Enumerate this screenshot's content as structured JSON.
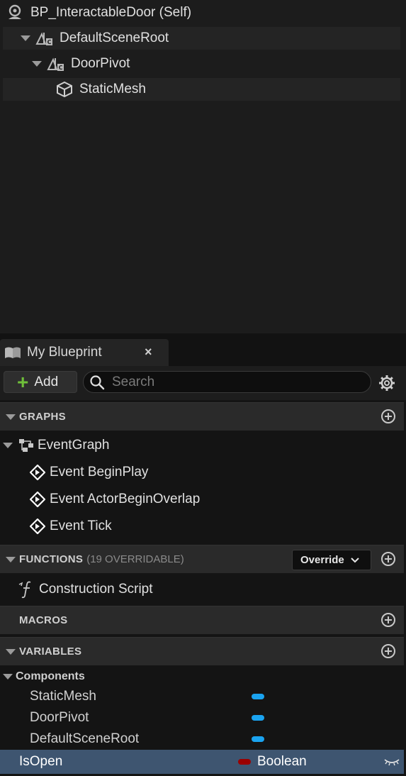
{
  "components_tree": {
    "items": [
      {
        "label": "BP_InteractableDoor (Self)"
      },
      {
        "label": "DefaultSceneRoot"
      },
      {
        "label": "DoorPivot"
      },
      {
        "label": "StaticMesh"
      }
    ]
  },
  "my_blueprint": {
    "tab_label": "My Blueprint",
    "close_glyph": "×",
    "add_label": "Add",
    "add_glyph": "+",
    "search_placeholder": "Search",
    "sections": {
      "graphs": {
        "title": "GRAPHS"
      },
      "functions": {
        "title": "FUNCTIONS",
        "subtitle": "(19 OVERRIDABLE)",
        "override_label": "Override"
      },
      "macros": {
        "title": "MACROS"
      },
      "variables": {
        "title": "VARIABLES"
      }
    },
    "graphs": {
      "event_graph": "EventGraph",
      "events": [
        "Event BeginPlay",
        "Event ActorBeginOverlap",
        "Event Tick"
      ]
    },
    "functions": [
      "Construction Script"
    ],
    "variables": {
      "category": "Components",
      "component_vars": [
        "StaticMesh",
        "DoorPivot",
        "DefaultSceneRoot"
      ],
      "selected": {
        "name": "IsOpen",
        "type": "Boolean"
      }
    }
  },
  "colors": {
    "object_type": "#1aa3f0",
    "boolean_type": "#9b0000",
    "add_plus": "#6fbf3a",
    "selection": "#3e5570"
  }
}
